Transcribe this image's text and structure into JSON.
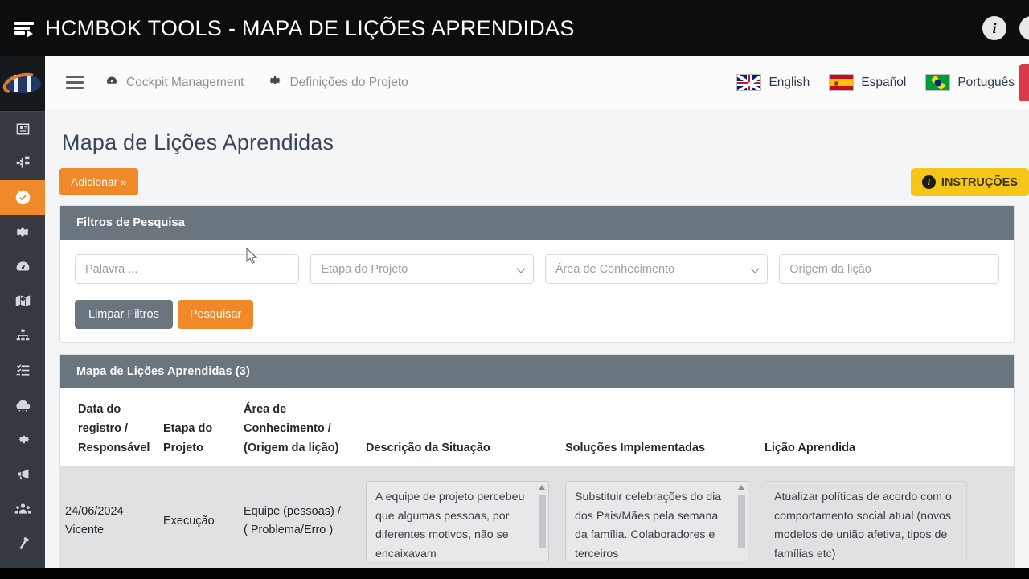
{
  "topbar": {
    "title": "HCMBOK TOOLS - MAPA DE LIÇÕES APRENDIDAS",
    "menu_icon": "sort-menu-icon",
    "info_icon_label": "i",
    "info_icon_2_label": "i"
  },
  "rail": {
    "logo_alt": "HCMBOK logo",
    "items": [
      {
        "name": "id-card-icon",
        "title": "Cadastro"
      },
      {
        "name": "sitemap-icon",
        "title": "Estrutura"
      },
      {
        "name": "check-circle-icon",
        "title": "Lições Aprendidas",
        "active": true
      },
      {
        "name": "gear-icon",
        "title": "Configurações"
      },
      {
        "name": "dashboard-icon",
        "title": "Cockpit"
      },
      {
        "name": "map-icon",
        "title": "Mapa"
      },
      {
        "name": "org-chart-icon",
        "title": "Organograma"
      },
      {
        "name": "checklist-icon",
        "title": "Checklist"
      },
      {
        "name": "cloud-icon",
        "title": "Nuvem"
      },
      {
        "name": "cog-icon",
        "title": "Ajustes"
      },
      {
        "name": "megaphone-icon",
        "title": "Comunicação"
      },
      {
        "name": "users-icon",
        "title": "Equipe"
      },
      {
        "name": "hammer-icon",
        "title": "Ferramentas"
      }
    ]
  },
  "nav": {
    "hamburger": "hamburger-icon",
    "links": [
      {
        "label": "Cockpit Management",
        "icon": "dashboard-icon"
      },
      {
        "label": "Definições do Projeto",
        "icon": "gear-icon"
      }
    ],
    "languages": [
      {
        "label": "English",
        "flag": "uk-flag-icon"
      },
      {
        "label": "Español",
        "flag": "spain-flag-icon"
      },
      {
        "label": "Português",
        "flag": "brazil-flag-icon"
      }
    ],
    "side_tab_color": "#d93a4a"
  },
  "page": {
    "title": "Mapa de Lições Aprendidas",
    "add_button": "Adicionar »",
    "instructions_button": "INSTRUÇÕES",
    "instructions_badge": "i"
  },
  "filters": {
    "panel_title": "Filtros de Pesquisa",
    "fields": [
      {
        "name": "keyword-input",
        "placeholder": "Palavra ...",
        "value": "",
        "type": "text"
      },
      {
        "name": "project-stage-select",
        "placeholder": "Etapa do Projeto",
        "value": "",
        "type": "select"
      },
      {
        "name": "knowledge-area-select",
        "placeholder": "Área de Conhecimento",
        "value": "",
        "type": "select"
      },
      {
        "name": "lesson-origin-select",
        "placeholder": "Origem da lição",
        "value": "",
        "type": "select"
      }
    ],
    "clear_button": "Limpar Filtros",
    "search_button": "Pesquisar"
  },
  "table": {
    "panel_title": "Mapa de Lições Aprendidas (3)",
    "count": 3,
    "columns": [
      "Data do registro / Responsável",
      "Etapa do Projeto",
      "Área de Conhecimento / (Origem da lição)",
      "Descrição da Situação",
      "Soluções Implementadas",
      "Lição Aprendida"
    ],
    "columns_lines": [
      [
        "Data do",
        "registro /",
        "Responsável"
      ],
      [
        "Etapa do",
        "Projeto"
      ],
      [
        "Área de",
        "Conhecimento /",
        "(Origem da lição)"
      ],
      [
        "Descrição da Situação"
      ],
      [
        "Soluções Implementadas"
      ],
      [
        "Lição Aprendida"
      ]
    ],
    "rows": [
      {
        "date": "24/06/2024",
        "responsible": "Vicente",
        "stage": "Execução",
        "area_line1": "Equipe (pessoas) /",
        "area_line2": "( Problema/Erro )",
        "situation": "A equipe de projeto percebeu que algumas pessoas, por diferentes motivos, não se encaixavam",
        "solutions": "Substituir celebrações do dia dos Pais/Mães pela semana da família. Colaboradores e terceiros",
        "lesson": "Atualizar políticas de acordo com o comportamento social atual (novos modelos de união afetiva, tipos de famílias etc)"
      }
    ]
  },
  "colors": {
    "accent_orange": "#f0892a",
    "panel_header": "#6b757e",
    "rail": "#343a40",
    "instructions_yellow": "#f5c518",
    "red_tab": "#d93a4a"
  }
}
